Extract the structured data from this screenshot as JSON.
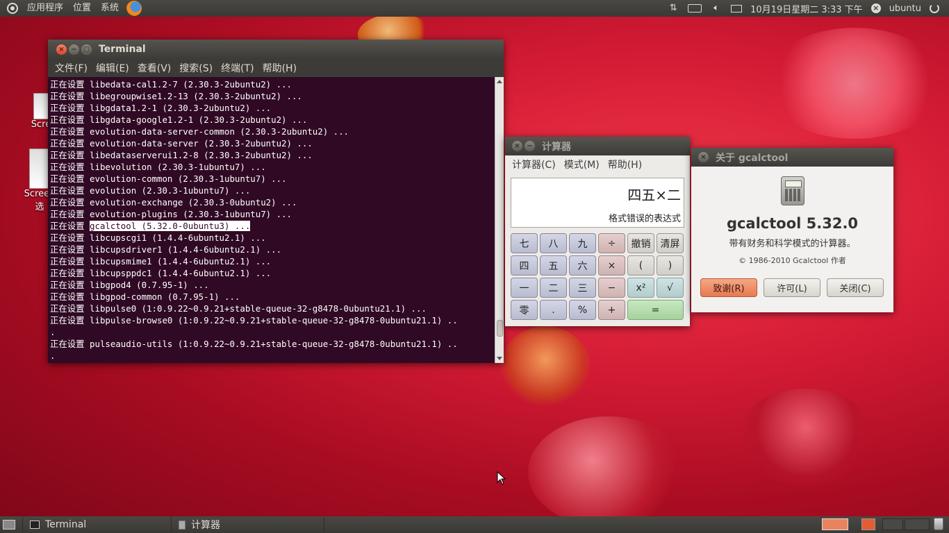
{
  "top_panel": {
    "menus": [
      "应用程序",
      "位置",
      "系统"
    ],
    "clock": "10月19日星期二  3:33 下午",
    "username": "ubuntu"
  },
  "desktop_icons": [
    {
      "label": "Scree",
      "label2": ""
    },
    {
      "label": "Screen",
      "label2": "选"
    }
  ],
  "terminal": {
    "title": "Terminal",
    "menu": [
      "文件(F)",
      "编辑(E)",
      "查看(V)",
      "搜索(S)",
      "终端(T)",
      "帮助(H)"
    ],
    "lines": [
      {
        "prefix": "正在设置 ",
        "text": "libedata-cal1.2-7 (2.30.3-2ubuntu2) ..."
      },
      {
        "prefix": "正在设置 ",
        "text": "libegroupwise1.2-13 (2.30.3-2ubuntu2) ..."
      },
      {
        "prefix": "正在设置 ",
        "text": "libgdata1.2-1 (2.30.3-2ubuntu2) ..."
      },
      {
        "prefix": "正在设置 ",
        "text": "libgdata-google1.2-1 (2.30.3-2ubuntu2) ..."
      },
      {
        "prefix": "正在设置 ",
        "text": "evolution-data-server-common (2.30.3-2ubuntu2) ..."
      },
      {
        "prefix": "正在设置 ",
        "text": "evolution-data-server (2.30.3-2ubuntu2) ..."
      },
      {
        "prefix": "正在设置 ",
        "text": "libedataserverui1.2-8 (2.30.3-2ubuntu2) ..."
      },
      {
        "prefix": "正在设置 ",
        "text": "libevolution (2.30.3-1ubuntu7) ..."
      },
      {
        "prefix": "正在设置 ",
        "text": "evolution-common (2.30.3-1ubuntu7) ..."
      },
      {
        "prefix": "正在设置 ",
        "text": "evolution (2.30.3-1ubuntu7) ..."
      },
      {
        "prefix": "正在设置 ",
        "text": "evolution-exchange (2.30.3-0ubuntu2) ..."
      },
      {
        "prefix": "正在设置 ",
        "text": "evolution-plugins (2.30.3-1ubuntu7) ..."
      },
      {
        "prefix": "正在设置 ",
        "text": "gcalctool (5.32.0-0ubuntu3) ...",
        "highlight": true
      },
      {
        "prefix": "正在设置 ",
        "text": "libcupscgi1 (1.4.4-6ubuntu2.1) ..."
      },
      {
        "prefix": "正在设置 ",
        "text": "libcupsdriver1 (1.4.4-6ubuntu2.1) ..."
      },
      {
        "prefix": "正在设置 ",
        "text": "libcupsmime1 (1.4.4-6ubuntu2.1) ..."
      },
      {
        "prefix": "正在设置 ",
        "text": "libcupsppdc1 (1.4.4-6ubuntu2.1) ..."
      },
      {
        "prefix": "正在设置 ",
        "text": "libgpod4 (0.7.95-1) ..."
      },
      {
        "prefix": "正在设置 ",
        "text": "libgpod-common (0.7.95-1) ..."
      },
      {
        "prefix": "正在设置 ",
        "text": "libpulse0 (1:0.9.22~0.9.21+stable-queue-32-g8478-0ubuntu21.1) ..."
      },
      {
        "prefix": "正在设置 ",
        "text": "libpulse-browse0 (1:0.9.22~0.9.21+stable-queue-32-g8478-0ubuntu21.1) .."
      },
      {
        "prefix": "",
        "text": "."
      },
      {
        "prefix": "正在设置 ",
        "text": "pulseaudio-utils (1:0.9.22~0.9.21+stable-queue-32-g8478-0ubuntu21.1) .."
      },
      {
        "prefix": "",
        "text": "."
      }
    ]
  },
  "calculator": {
    "title": "计算器",
    "menu": [
      "计算器(C)",
      "模式(M)",
      "帮助(H)"
    ],
    "expression": "四五×二",
    "status": "格式错误的表达式",
    "buttons": [
      {
        "label": "七",
        "kind": "num"
      },
      {
        "label": "八",
        "kind": "num"
      },
      {
        "label": "九",
        "kind": "num"
      },
      {
        "label": "÷",
        "kind": "op"
      },
      {
        "label": "撤销",
        "kind": "fn"
      },
      {
        "label": "清屏",
        "kind": "fn"
      },
      {
        "label": "四",
        "kind": "num"
      },
      {
        "label": "五",
        "kind": "num"
      },
      {
        "label": "六",
        "kind": "num"
      },
      {
        "label": "×",
        "kind": "op"
      },
      {
        "label": "(",
        "kind": "fn"
      },
      {
        "label": ")",
        "kind": "fn"
      },
      {
        "label": "一",
        "kind": "num"
      },
      {
        "label": "二",
        "kind": "num"
      },
      {
        "label": "三",
        "kind": "num"
      },
      {
        "label": "−",
        "kind": "op"
      },
      {
        "label": "x²",
        "kind": "sq"
      },
      {
        "label": "√",
        "kind": "sq"
      },
      {
        "label": "零",
        "kind": "num"
      },
      {
        "label": ".",
        "kind": "num"
      },
      {
        "label": "%",
        "kind": "num"
      },
      {
        "label": "+",
        "kind": "op"
      },
      {
        "label": "=",
        "kind": "eq"
      }
    ]
  },
  "about": {
    "title": "关于 gcalctool",
    "app_name": "gcalctool 5.32.0",
    "description": "带有财务和科学模式的计算器。",
    "copyright": "© 1986-2010 Gcalctool 作者",
    "credits_label": "致谢(R)",
    "license_label": "许可(L)",
    "close_label": "关闭(C)"
  },
  "bottom_panel": {
    "tasks": [
      {
        "label": "Terminal"
      },
      {
        "label": "计算器"
      }
    ]
  }
}
